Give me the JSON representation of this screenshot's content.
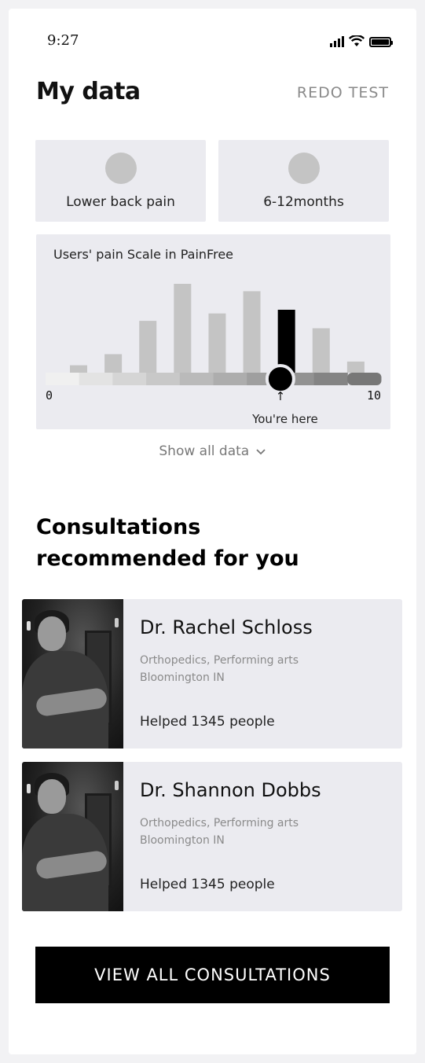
{
  "status_bar": {
    "time": "9:27"
  },
  "header": {
    "title": "My data",
    "redo_label": "REDO TEST"
  },
  "tiles": [
    {
      "label": "Lower back pain"
    },
    {
      "label": "6-12months"
    }
  ],
  "pain_chart": {
    "title": "Users' pain Scale in PainFree",
    "scale_min_label": "0",
    "scale_max_label": "10",
    "marker_arrow": "↑",
    "marker_label": "You're here",
    "show_all_label": "Show all data",
    "show_all_icon": "chevron-down-icon"
  },
  "chart_data": {
    "type": "bar",
    "title": "Users' pain Scale in PainFree",
    "xlim": [
      0,
      10
    ],
    "values": [
      2,
      5,
      14,
      24,
      16,
      22,
      17,
      12,
      3
    ],
    "highlight_index": 6,
    "user_position": 7,
    "ylim": [
      0,
      24
    ],
    "colors": {
      "bar": "#c4c4c4",
      "highlight": "#000000"
    }
  },
  "consultations": {
    "heading_line1": "Consultations",
    "heading_line2": "recommended for you",
    "doctors": [
      {
        "name": "Dr. Rachel Schloss",
        "specialty": "Orthopedics, Performing arts",
        "location": "Bloomington IN",
        "helped": "Helped 1345 people"
      },
      {
        "name": "Dr. Shannon Dobbs",
        "specialty": "Orthopedics, Performing arts",
        "location": "Bloomington IN",
        "helped": "Helped 1345 people"
      }
    ],
    "view_all_label": "VIEW ALL CONSULTATIONS"
  }
}
